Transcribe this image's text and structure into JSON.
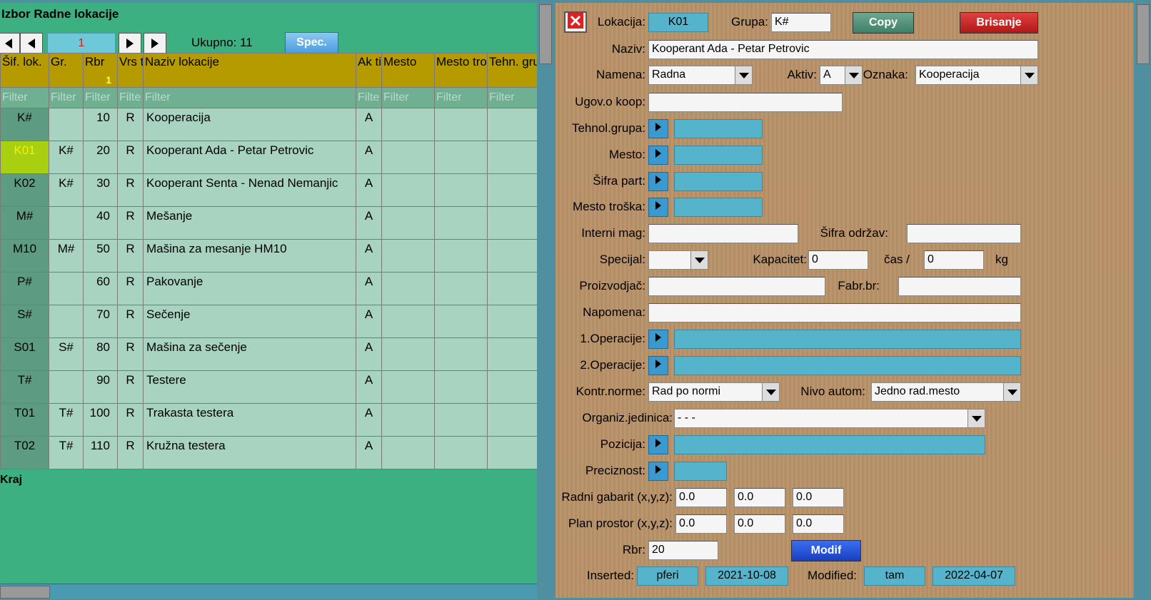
{
  "list": {
    "title": "Izbor Radne lokacije",
    "page": "1",
    "total_label": "Ukupno: 11",
    "spec_label": "Spec.",
    "columns": [
      "Šif. lok.",
      "Gr.",
      "Rbr",
      "Vrs ta",
      "Naziv lokacije",
      "Ak tiv",
      "Mesto",
      "Mesto troška",
      "Tehn. grupa"
    ],
    "sort_indicator": "1",
    "filters": [
      "Filter",
      "Filter",
      "Filter",
      "Filte",
      "Filter",
      "Filte",
      "Filter",
      "Filter",
      "Filter"
    ],
    "rows": [
      {
        "code": "K#",
        "group": "",
        "rbr": "10",
        "vrsta": "R",
        "naziv": "Kooperacija",
        "aktiv": "A"
      },
      {
        "code": "K01",
        "group": "K#",
        "rbr": "20",
        "vrsta": "R",
        "naziv": "Kooperant Ada - Petar Petrovic",
        "aktiv": "A"
      },
      {
        "code": "K02",
        "group": "K#",
        "rbr": "30",
        "vrsta": "R",
        "naziv": "Kooperant Senta - Nenad Nemanjic",
        "aktiv": "A"
      },
      {
        "code": "M#",
        "group": "",
        "rbr": "40",
        "vrsta": "R",
        "naziv": "Mešanje",
        "aktiv": "A"
      },
      {
        "code": "M10",
        "group": "M#",
        "rbr": "50",
        "vrsta": "R",
        "naziv": "Mašina za mesanje HM10",
        "aktiv": "A"
      },
      {
        "code": "P#",
        "group": "",
        "rbr": "60",
        "vrsta": "R",
        "naziv": "Pakovanje",
        "aktiv": "A"
      },
      {
        "code": "S#",
        "group": "",
        "rbr": "70",
        "vrsta": "R",
        "naziv": "Sečenje",
        "aktiv": "A"
      },
      {
        "code": "S01",
        "group": "S#",
        "rbr": "80",
        "vrsta": "R",
        "naziv": "Mašina za sečenje",
        "aktiv": "A"
      },
      {
        "code": "T#",
        "group": "",
        "rbr": "90",
        "vrsta": "R",
        "naziv": "Testere",
        "aktiv": "A"
      },
      {
        "code": "T01",
        "group": "T#",
        "rbr": "100",
        "vrsta": "R",
        "naziv": "Trakasta testera",
        "aktiv": "A"
      },
      {
        "code": "T02",
        "group": "T#",
        "rbr": "110",
        "vrsta": "R",
        "naziv": "Kružna testera",
        "aktiv": "A"
      }
    ],
    "end_label": "Kraj"
  },
  "form": {
    "labels": {
      "lokacija": "Lokacija:",
      "grupa": "Grupa:",
      "naziv": "Naziv:",
      "namena": "Namena:",
      "aktiv": "Aktiv:",
      "oznaka": "Oznaka:",
      "ugov": "Ugov.o koop:",
      "tehnol": "Tehnol.grupa:",
      "mesto": "Mesto:",
      "sifra_part": "Šifra part:",
      "mesto_troska": "Mesto troška:",
      "interni_mag": "Interni mag:",
      "sifra_odrzav": "Šifra održav:",
      "specijal": "Specijal:",
      "kapacitet": "Kapacitet:",
      "cas": "čas /",
      "kg": "kg",
      "proizvodjac": "Proizvodjač:",
      "fabr_br": "Fabr.br:",
      "napomena": "Napomena:",
      "op1": "1.Operacije:",
      "op2": "2.Operacije:",
      "kontr_norme": "Kontr.norme:",
      "nivo_autom": "Nivo autom:",
      "organiz": "Organiz.jedinica:",
      "pozicija": "Pozicija:",
      "preciznost": "Preciznost:",
      "radni_gabarit": "Radni gabarit (x,y,z):",
      "plan_prostor": "Plan prostor (x,y,z):",
      "rbr": "Rbr:",
      "inserted": "Inserted:",
      "modified": "Modified:"
    },
    "values": {
      "lokacija": "K01",
      "grupa": "K#",
      "naziv": "Kooperant Ada - Petar Petrovic",
      "namena": "Radna",
      "aktiv": "A",
      "oznaka": "Kooperacija",
      "ugov": "",
      "interni_mag": "",
      "sifra_odrzav": "",
      "specijal": "",
      "kapacitet": "0",
      "cas_kg": "0",
      "proizvodjac": "",
      "fabr_br": "",
      "napomena": "",
      "kontr_norme": "Rad po normi",
      "nivo_autom": "Jedno rad.mesto",
      "organiz": "- - -",
      "radni_gabarit": [
        "0.0",
        "0.0",
        "0.0"
      ],
      "plan_prostor": [
        "0.0",
        "0.0",
        "0.0"
      ],
      "rbr": "20",
      "inserted_by": "pferi",
      "inserted_date": "2021-10-08",
      "modified_by": "tam",
      "modified_date": "2022-04-07"
    },
    "buttons": {
      "copy": "Copy",
      "delete": "Brisanje",
      "modif": "Modif"
    }
  },
  "colors": {
    "list_bg": "#3cb080",
    "header_bg": "#b59b00",
    "selected_code_bg": "#a8cf10",
    "form_bg": "#b89268",
    "lookup_field": "#55b4cc"
  }
}
